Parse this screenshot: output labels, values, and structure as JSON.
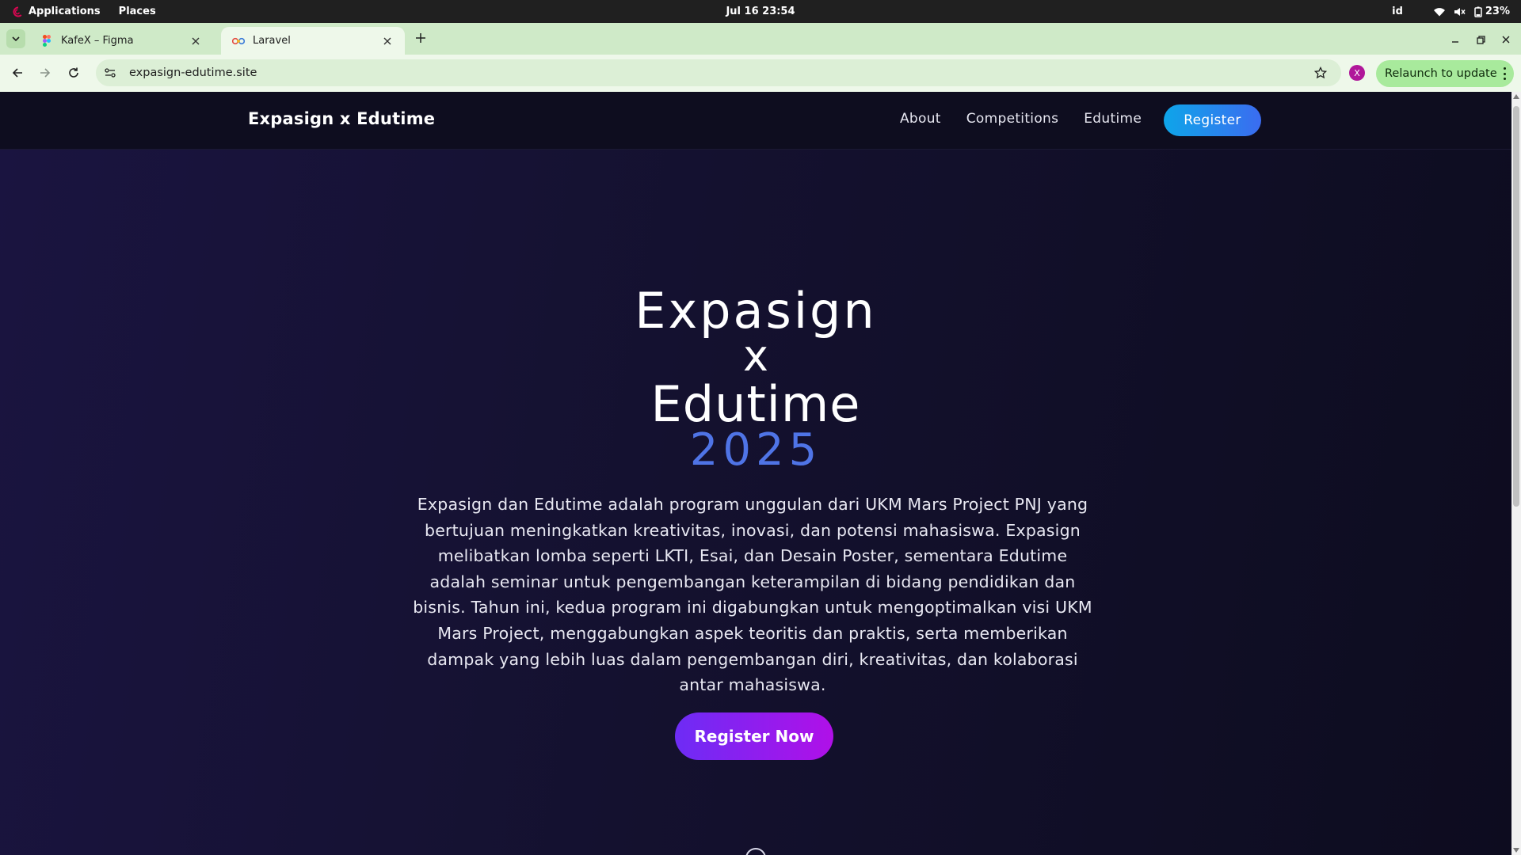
{
  "system_bar": {
    "applications": "Applications",
    "places": "Places",
    "clock": "Jul 16  23:54",
    "keyboard_layout": "id",
    "battery": "23%"
  },
  "browser": {
    "tabs": [
      {
        "title": "KafeX – Figma",
        "icon": "figma-icon",
        "active": false
      },
      {
        "title": "Laravel",
        "icon": "laravel-icon",
        "active": true
      }
    ],
    "url": "expasign-edutime.site",
    "relaunch_label": "Relaunch to update",
    "profile_initial": "X"
  },
  "site": {
    "brand": "Expasign x Edutime",
    "nav": {
      "about": "About",
      "competitions": "Competitions",
      "edutime": "Edutime",
      "register": "Register"
    },
    "hero": {
      "line1": "Expasign",
      "line2": "x",
      "line3": "Edutime",
      "year": "2025",
      "description": "Expasign dan Edutime adalah program unggulan dari UKM Mars Project PNJ yang bertujuan meningkatkan kreativitas, inovasi, dan potensi mahasiswa. Expasign melibatkan lomba seperti LKTI, Esai, dan Desain Poster, sementara Edutime adalah seminar untuk pengembangan keterampilan di bidang pendidikan dan bisnis. Tahun ini, kedua program ini digabungkan untuk mengoptimalkan visi UKM Mars Project, menggabungkan aspek teoritis dan praktis, serta memberikan dampak yang lebih luas dalam pengembangan diri, kreativitas, dan kolaborasi antar mahasiswa.",
      "cta": "Register Now"
    }
  },
  "colors": {
    "accent_year": "#4f74e6",
    "nav_register_gradient": [
      "#0ea5e9",
      "#3b6cf0"
    ],
    "cta_gradient": [
      "#6d2cf5",
      "#b010e8"
    ],
    "tabstrip": "#cfeac8",
    "relaunch": "#a8ea9c"
  }
}
